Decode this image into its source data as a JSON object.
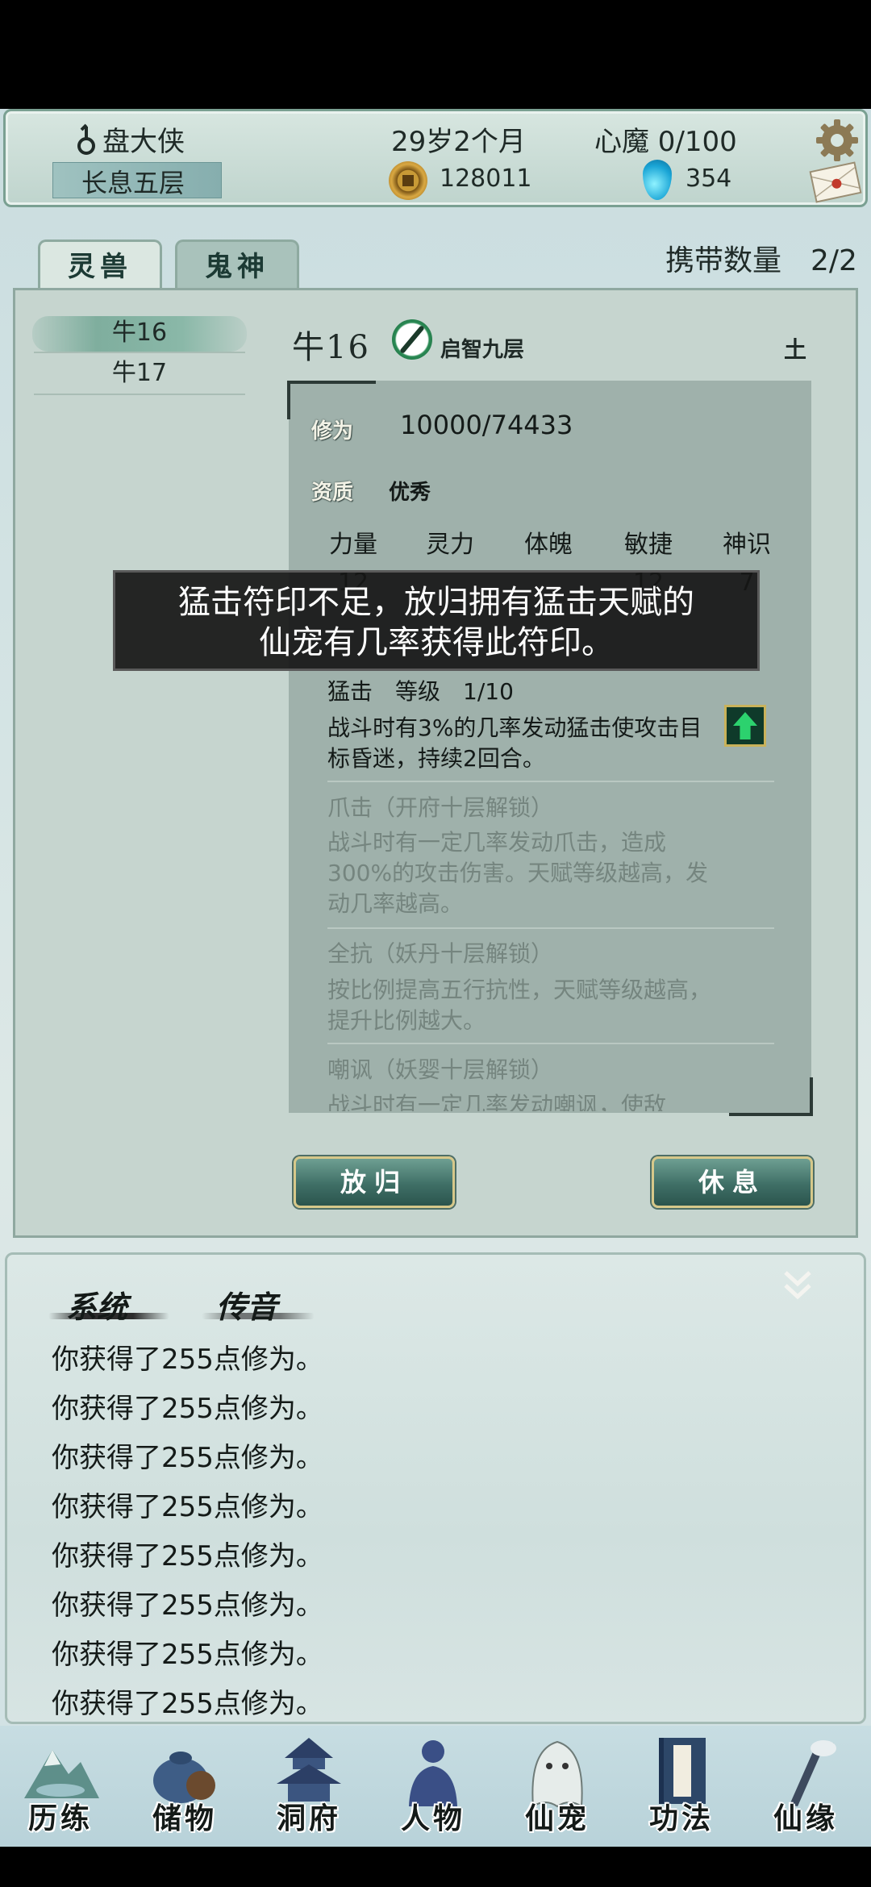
{
  "header": {
    "player_name": "盘大侠",
    "realm": "长息五层",
    "age": "29岁2个月",
    "demon": "心魔 0/100",
    "coins": "128011",
    "gems": "354"
  },
  "tabs": [
    "灵兽",
    "鬼神"
  ],
  "carry_count": "携带数量　2/2",
  "pets": [
    "牛16",
    "牛17"
  ],
  "pet_detail": {
    "name": "牛16",
    "stage": "启智九层",
    "element": "土",
    "cultivation_label": "修为",
    "cultivation_value": "10000/74433",
    "aptitude_label": "资质",
    "aptitude_value": "优秀",
    "stat_labels": [
      "力量",
      "灵力",
      "体魄",
      "敏捷",
      "神识"
    ],
    "stat_values": [
      "12",
      "",
      "",
      "12",
      "7"
    ],
    "skills": [
      {
        "title": "猛击　等级　1/10",
        "desc": "战斗时有3%的几率发动猛击使攻击目标昏迷，持续2回合。"
      },
      {
        "title": "爪击（开府十层解锁）",
        "desc": "战斗时有一定几率发动爪击，造成300%的攻击伤害。天赋等级越高，发动几率越高。"
      },
      {
        "title": "全抗（妖丹十层解锁）",
        "desc": "按比例提高五行抗性，天赋等级越高，提升比例越大。"
      },
      {
        "title": "嘲讽（妖婴十层解锁）",
        "desc": "战斗时有一定几率发动嘲讽，使敌"
      }
    ]
  },
  "toast": {
    "line1": "猛击符印不足，放归拥有猛击天赋的",
    "line2": "仙宠有几率获得此符印。"
  },
  "buttons": {
    "release": "放归",
    "rest": "休息"
  },
  "chat": {
    "tabs": [
      "系统",
      "传音"
    ],
    "messages": [
      "你获得了255点修为。",
      "你获得了255点修为。",
      "你获得了255点修为。",
      "你获得了255点修为。",
      "你获得了255点修为。",
      "你获得了255点修为。",
      "你获得了255点修为。",
      "你获得了255点修为。"
    ]
  },
  "nav": [
    "历练",
    "储物",
    "洞府",
    "人物",
    "仙宠",
    "功法",
    "仙缘"
  ],
  "icons": {
    "gender": "male-symbol-icon",
    "coin": "copper-coin-icon",
    "gem": "blue-spirit-stone-icon",
    "settings": "gear-icon",
    "mail": "mail-envelope-icon",
    "brush": "brush-rename-icon",
    "upgrade": "green-up-arrow-icon",
    "collapse": "double-chevron-down-icon"
  },
  "colors": {
    "accent_green": "#2cd26e",
    "panel": "#9fb1ab",
    "gem": "#1aa5d6",
    "coin": "#c89a36"
  }
}
